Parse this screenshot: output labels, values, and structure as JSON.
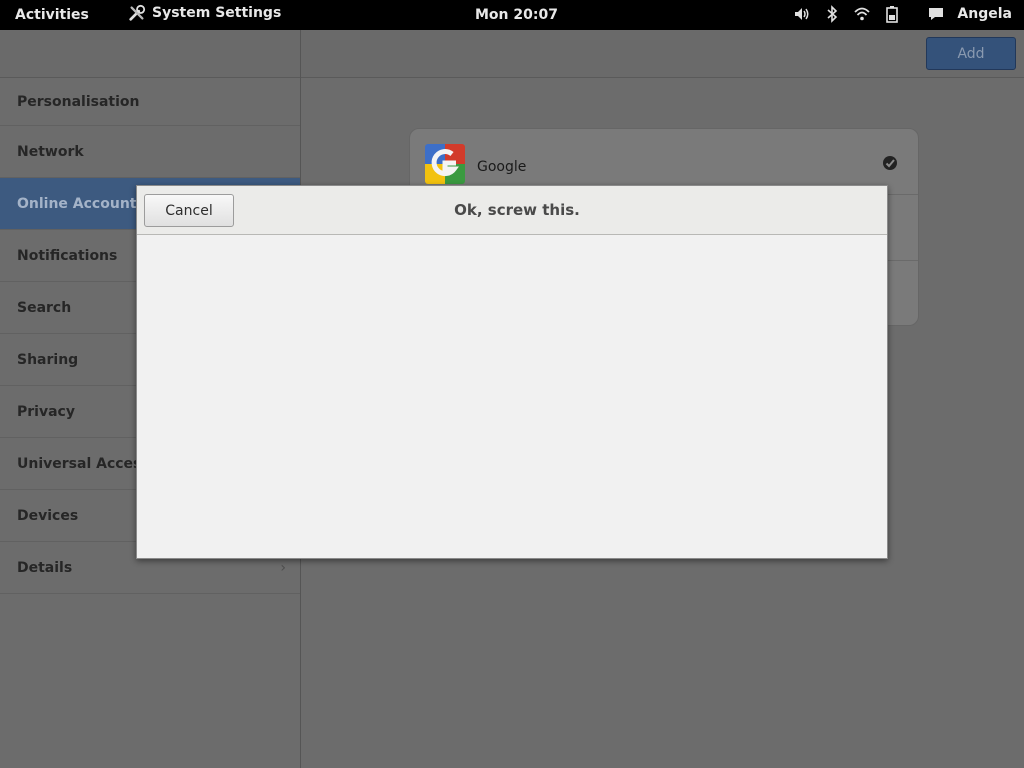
{
  "topbar": {
    "activities": "Activities",
    "app_name": "System Settings",
    "clock": "Mon 20:07",
    "user": "Angela"
  },
  "header": {
    "add_label": "Add"
  },
  "sidebar": {
    "items": [
      {
        "label": "Personalisation"
      },
      {
        "label": "Network"
      },
      {
        "label": "Online Accounts",
        "selected": true
      },
      {
        "label": "Notifications"
      },
      {
        "label": "Search"
      },
      {
        "label": "Sharing"
      },
      {
        "label": "Privacy"
      },
      {
        "label": "Universal Access"
      },
      {
        "label": "Devices"
      },
      {
        "label": "Details"
      }
    ]
  },
  "accounts": [
    {
      "name": "Google",
      "icon": "google-logo-icon",
      "status_icon": "check-icon"
    }
  ],
  "dialog": {
    "cancel_label": "Cancel",
    "title": "Ok, screw this."
  },
  "colors": {
    "selected_bg": "#3d5a80",
    "add_button_bg": "#34527a",
    "dialog_bg": "#f1f1f1"
  }
}
